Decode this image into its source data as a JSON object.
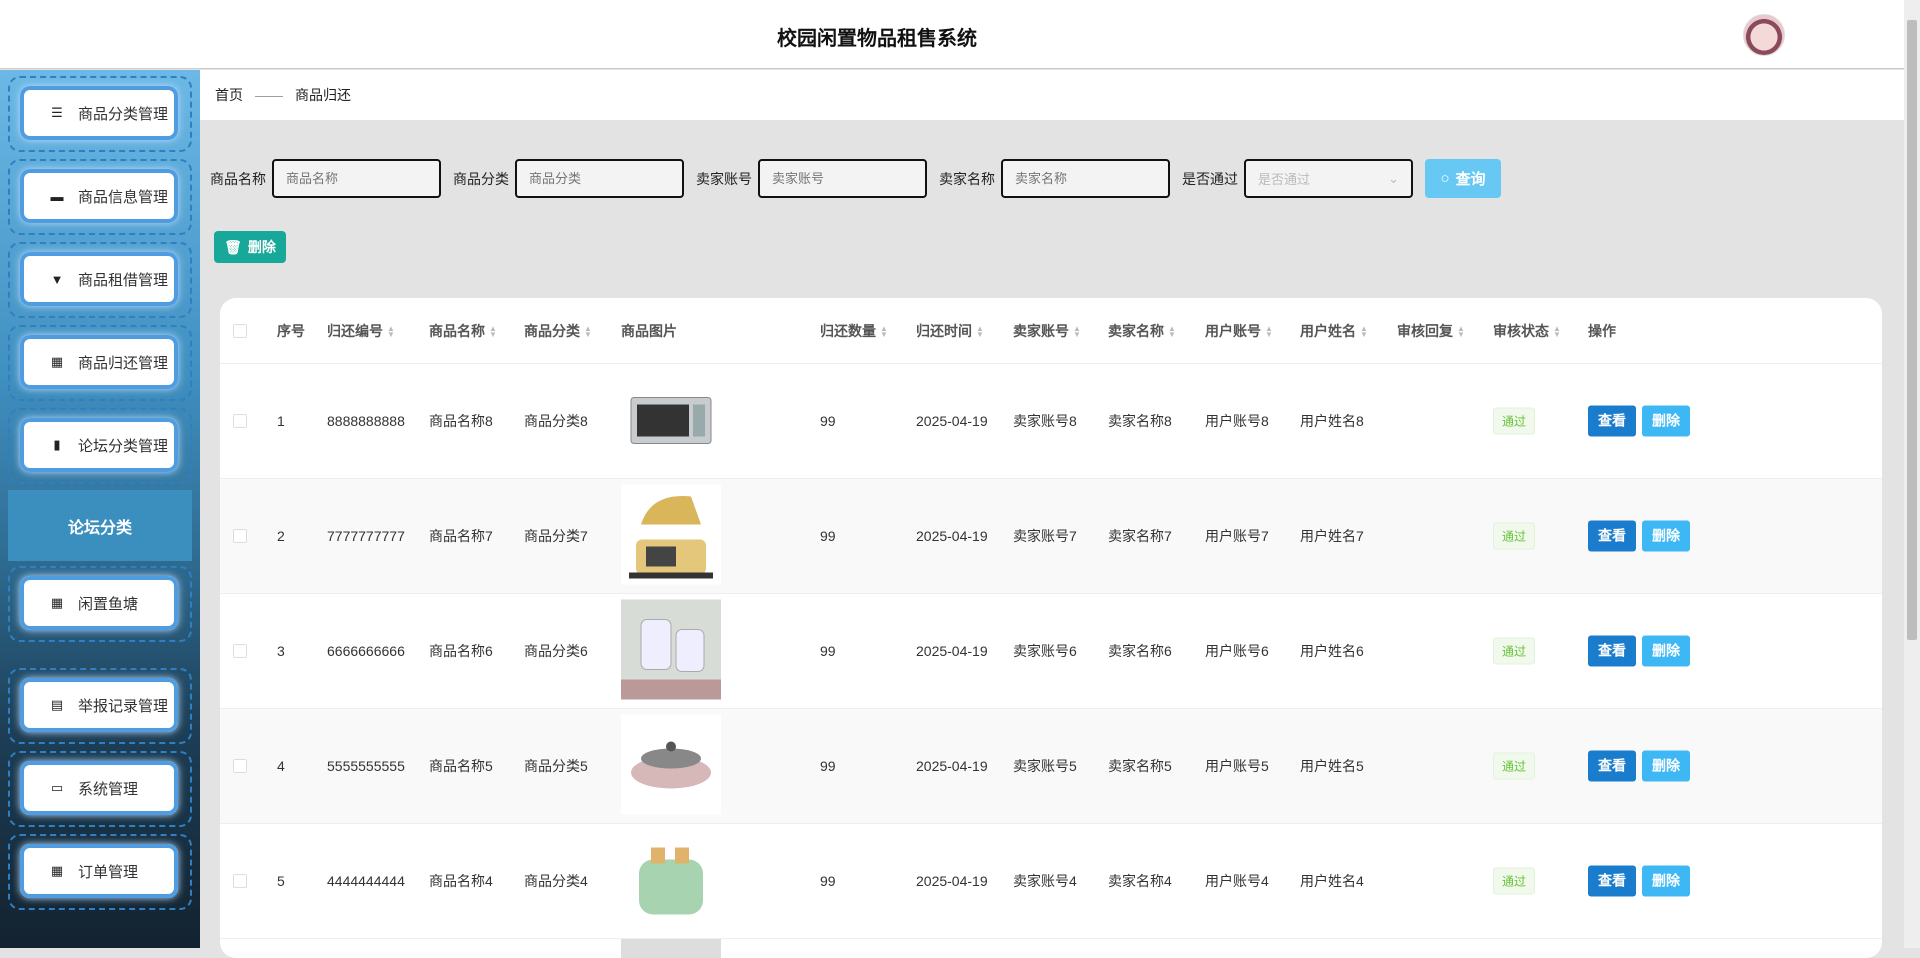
{
  "header": {
    "title": "校园闲置物品租售系统"
  },
  "sidebar": {
    "items": [
      {
        "label": "商品分类管理",
        "icon": "menu-icon"
      },
      {
        "label": "商品信息管理",
        "icon": "monitor-icon"
      },
      {
        "label": "商品租借管理",
        "icon": "brush-icon"
      },
      {
        "label": "商品归还管理",
        "icon": "grid-icon"
      },
      {
        "label": "论坛分类管理",
        "icon": "library-icon"
      },
      {
        "label": "闲置鱼塘",
        "icon": "grid-icon"
      },
      {
        "label": "举报记录管理",
        "icon": "clipboard-icon"
      },
      {
        "label": "系统管理",
        "icon": "briefcase-icon"
      },
      {
        "label": "订单管理",
        "icon": "grid-icon"
      }
    ],
    "submenu": "论坛分类"
  },
  "breadcrumb": {
    "home": "首页",
    "sep": "——",
    "current": "商品归还"
  },
  "search": {
    "fields": [
      {
        "label": "商品名称",
        "placeholder": "商品名称"
      },
      {
        "label": "商品分类",
        "placeholder": "商品分类"
      },
      {
        "label": "卖家账号",
        "placeholder": "卖家账号"
      },
      {
        "label": "卖家名称",
        "placeholder": "卖家名称"
      }
    ],
    "select": {
      "label": "是否通过",
      "placeholder": "是否通过"
    },
    "query": "查询"
  },
  "toolbar": {
    "delete": "删除"
  },
  "table": {
    "headers": [
      "序号",
      "归还编号",
      "商品名称",
      "商品分类",
      "商品图片",
      "归还数量",
      "归还时间",
      "卖家账号",
      "卖家名称",
      "用户账号",
      "用户姓名",
      "审核回复",
      "审核状态",
      "操作"
    ],
    "rows": [
      {
        "idx": "1",
        "code": "8888888888",
        "name": "商品名称8",
        "cat": "商品分类8",
        "image": "oven",
        "qty": "99",
        "time": "2025-04-19",
        "sacc": "卖家账号8",
        "sname": "卖家名称8",
        "uacc": "用户账号8",
        "uname": "用户姓名8",
        "reply": "",
        "status": "通过"
      },
      {
        "idx": "2",
        "code": "7777777777",
        "name": "商品名称7",
        "cat": "商品分类7",
        "image": "steam-iron",
        "qty": "99",
        "time": "2025-04-19",
        "sacc": "卖家账号7",
        "sname": "卖家名称7",
        "uacc": "用户账号7",
        "uname": "用户姓名7",
        "reply": "",
        "status": "通过"
      },
      {
        "idx": "3",
        "code": "6666666666",
        "name": "商品名称6",
        "cat": "商品分类6",
        "image": "food-processor",
        "qty": "99",
        "time": "2025-04-19",
        "sacc": "卖家账号6",
        "sname": "卖家名称6",
        "uacc": "用户账号6",
        "uname": "用户姓名6",
        "reply": "",
        "status": "通过"
      },
      {
        "idx": "4",
        "code": "5555555555",
        "name": "商品名称5",
        "cat": "商品分类5",
        "image": "hot-pot",
        "qty": "99",
        "time": "2025-04-19",
        "sacc": "卖家账号5",
        "sname": "卖家名称5",
        "uacc": "用户账号5",
        "uname": "用户姓名5",
        "reply": "",
        "status": "通过"
      },
      {
        "idx": "5",
        "code": "4444444444",
        "name": "商品名称4",
        "cat": "商品分类4",
        "image": "toaster",
        "qty": "99",
        "time": "2025-04-19",
        "sacc": "卖家账号4",
        "sname": "卖家名称4",
        "uacc": "用户账号4",
        "uname": "用户姓名4",
        "reply": "",
        "status": "通过"
      }
    ],
    "actions": {
      "view": "查看",
      "delete": "删除"
    }
  },
  "colors": {
    "accent": "#1a7ccc",
    "delete_light": "#3db8f5",
    "toolbar_delete": "#17a89a",
    "query": "#67c8f4",
    "pass": "#67c23a"
  }
}
